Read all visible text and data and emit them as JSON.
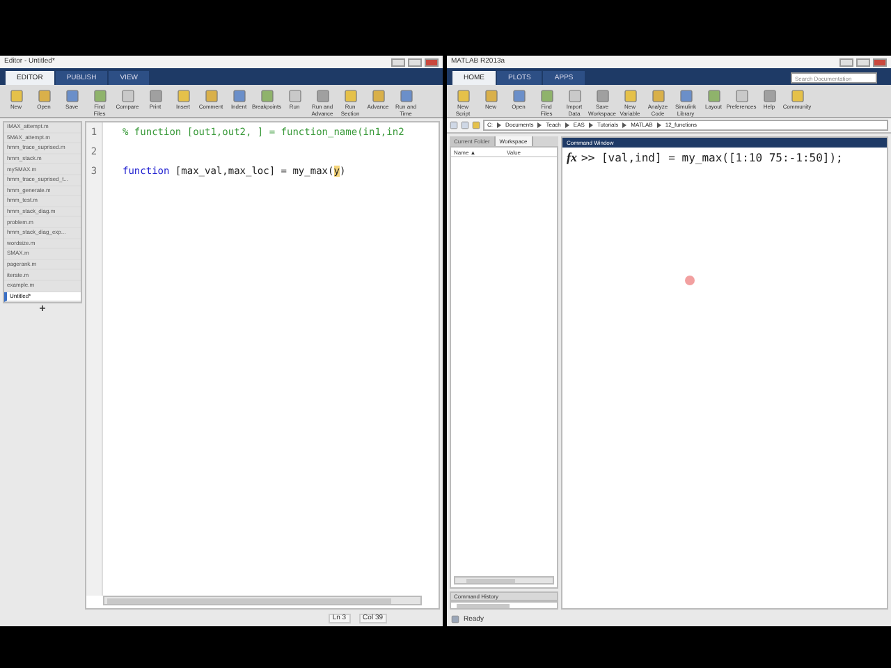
{
  "editor_window": {
    "title": "Editor - Untitled*",
    "tabs": [
      {
        "label": "EDITOR",
        "selected": true
      },
      {
        "label": "PUBLISH",
        "selected": false
      },
      {
        "label": "VIEW",
        "selected": false
      }
    ],
    "toolstrip": [
      {
        "label": "New"
      },
      {
        "label": "Open"
      },
      {
        "label": "Save"
      },
      {
        "label": "Find Files"
      },
      {
        "label": "Compare"
      },
      {
        "label": "Print"
      },
      {
        "label": "Insert"
      },
      {
        "label": "Comment"
      },
      {
        "label": "Indent"
      },
      {
        "label": "Breakpoints"
      },
      {
        "label": "Run"
      },
      {
        "label": "Run and Advance"
      },
      {
        "label": "Run Section"
      },
      {
        "label": "Advance"
      },
      {
        "label": "Run and Time"
      }
    ],
    "files": [
      {
        "name": "IMAX_attempt.m",
        "selected": false
      },
      {
        "name": "5MAX_attempt.m",
        "selected": false
      },
      {
        "name": "hmm_trace_suprised.m",
        "selected": false
      },
      {
        "name": "hmm_stack.m",
        "selected": false
      },
      {
        "name": "mySMAX.m",
        "selected": false
      },
      {
        "name": "hmm_trace_suprised_t...",
        "selected": false
      },
      {
        "name": "hmm_generate.m",
        "selected": false
      },
      {
        "name": "hmm_test.m",
        "selected": false
      },
      {
        "name": "hmm_stack_diag.m",
        "selected": false
      },
      {
        "name": "problem.m",
        "selected": false
      },
      {
        "name": "hmm_stack_diag_exp...",
        "selected": false
      },
      {
        "name": "wordsize.m",
        "selected": false
      },
      {
        "name": "SMAX.m",
        "selected": false
      },
      {
        "name": "pagerank.m",
        "selected": false
      },
      {
        "name": "iterate.m",
        "selected": false
      },
      {
        "name": "example.m",
        "selected": false
      },
      {
        "name": "Untitled*",
        "selected": true
      }
    ],
    "code_lines": [
      {
        "number": "1",
        "segments": [
          {
            "text": "% function [out1,out2, ] = function_name(in1,in2",
            "kind": "comment"
          }
        ]
      },
      {
        "number": "2"
      },
      {
        "number": "3",
        "segments": [
          {
            "text": "function",
            "kind": "keyword"
          },
          {
            "text": " [max_val,max_loc] = my_max(",
            "kind": "plain"
          },
          {
            "text": "y",
            "kind": "highlight"
          },
          {
            "text": ")",
            "kind": "plain"
          }
        ]
      }
    ],
    "status": [
      "Ln 3",
      "Col 39"
    ]
  },
  "matlab_window": {
    "title": "MATLAB R2013a",
    "tabs": [
      {
        "label": "HOME",
        "selected": true
      },
      {
        "label": "PLOTS",
        "selected": false
      },
      {
        "label": "APPS",
        "selected": false
      }
    ],
    "search": {
      "placeholder": "Search Documentation"
    },
    "toolstrip": [
      {
        "label": "New Script"
      },
      {
        "label": "New"
      },
      {
        "label": "Open"
      },
      {
        "label": "Find Files"
      },
      {
        "label": "Import Data"
      },
      {
        "label": "Save Workspace"
      },
      {
        "label": "New Variable"
      },
      {
        "label": "Analyze Code"
      },
      {
        "label": "Simulink Library"
      },
      {
        "label": "Layout"
      },
      {
        "label": "Preferences"
      },
      {
        "label": "Help"
      },
      {
        "label": "Community"
      }
    ],
    "path": [
      "C:",
      "Documents",
      "Teach",
      "EAS",
      "Tutorials",
      "MATLAB",
      "12_functions"
    ],
    "panel_tabs": [
      {
        "label": "Current Folder",
        "selected": false
      },
      {
        "label": "Workspace",
        "selected": true
      }
    ],
    "columns": [
      "Name ▲",
      "Value"
    ],
    "command_window": {
      "title": "Command Window",
      "function_browser": "fx",
      "prompt": ">>",
      "command": "[val,ind] = my_max([1:10 75:-1:50]);"
    },
    "history_title": "Command History",
    "status": "Ready"
  }
}
